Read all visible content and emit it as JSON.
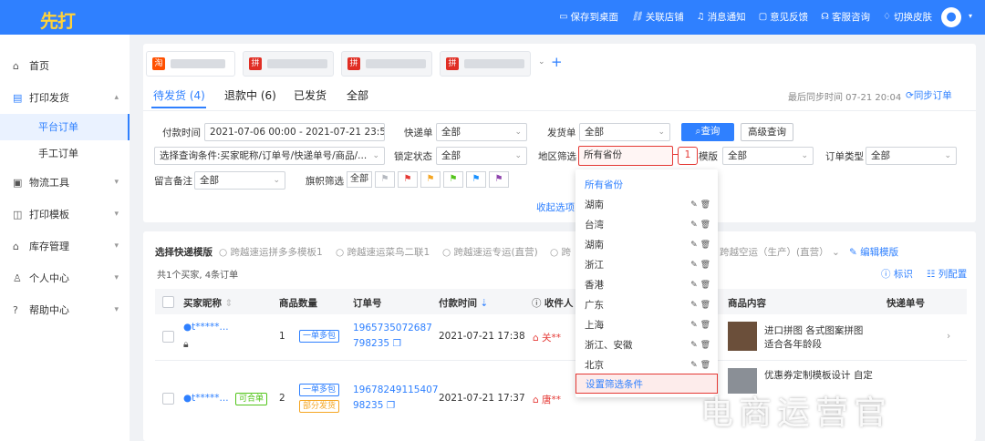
{
  "app": {
    "logo": "先打"
  },
  "topnav": [
    {
      "icon": "screen-icon",
      "label": "保存到桌面"
    },
    {
      "icon": "link-icon",
      "label": "关联店铺"
    },
    {
      "icon": "bell-icon",
      "label": "消息通知"
    },
    {
      "icon": "feedback-icon",
      "label": "意见反馈"
    },
    {
      "icon": "headset-icon",
      "label": "客服咨询"
    },
    {
      "icon": "shirt-icon",
      "label": "切换皮肤"
    }
  ],
  "sidebar": {
    "items": [
      {
        "icon": "home-icon",
        "label": "首页"
      },
      {
        "icon": "printer-icon",
        "label": "打印发货"
      },
      {
        "icon": "truck-icon",
        "label": "物流工具"
      },
      {
        "icon": "template-icon",
        "label": "打印模板"
      },
      {
        "icon": "store-icon",
        "label": "库存管理"
      },
      {
        "icon": "user-icon",
        "label": "个人中心"
      },
      {
        "icon": "help-icon",
        "label": "帮助中心"
      }
    ],
    "sub": [
      {
        "label": "平台订单"
      },
      {
        "label": "手工订单"
      }
    ]
  },
  "shops": [
    {
      "badge": "淘",
      "color": "#ff5000"
    },
    {
      "badge": "拼",
      "color": "#e02e24"
    },
    {
      "badge": "拼",
      "color": "#e02e24"
    },
    {
      "badge": "拼",
      "color": "#e02e24"
    }
  ],
  "tabs": [
    {
      "label": "待发货 (4)"
    },
    {
      "label": "退款中 (6)"
    },
    {
      "label": "已发货"
    },
    {
      "label": "全部"
    }
  ],
  "sync": {
    "text": "最后同步时间 07-21 20:04",
    "link": "同步订单"
  },
  "filters": {
    "pay_time_label": "付款时间",
    "pay_time_value": "2021-07-06 00:00 - 2021-07-21 23:59",
    "express_label": "快递单",
    "express_value": "全部",
    "ship_label": "发货单",
    "ship_value": "全部",
    "query_btn": "查询",
    "adv_btn": "高级查询",
    "cond_value": "选择查询条件:买家昵称/订单号/快递单号/商品/...",
    "lock_label": "锁定状态",
    "lock_value": "全部",
    "region_label": "地区筛选",
    "region_value": "所有省份",
    "template_label": "模版",
    "template_value": "全部",
    "order_type_label": "订单类型",
    "order_type_value": "全部",
    "remark_label": "留言备注",
    "remark_value": "全部",
    "flag_label": "旗帜筛选",
    "flag_all": "全部",
    "collapse": "收起选项",
    "callout": "1"
  },
  "flags": [
    "#b5b9c0",
    "#e53935",
    "#f5a623",
    "#52c41a",
    "#1890ff",
    "#8e44ad"
  ],
  "region_dropdown": {
    "header": "所有省份",
    "items": [
      "湖南",
      "台湾",
      "湖南",
      "浙江",
      "香港",
      "广东",
      "上海",
      "浙江、安徽",
      "北京"
    ],
    "footer": "设置筛选条件"
  },
  "express_select": {
    "label": "选择快递模版",
    "options": [
      "跨越速运拼多多模板1",
      "跨越速运菜鸟二联1",
      "跨越速运专运(直营)",
      "跨",
      "跨越空运（生产）(直营）"
    ],
    "edit": "编辑模版"
  },
  "summary": {
    "text": "共1个买家,   4条订单",
    "mark": "标识",
    "columns_cfg": "列配置"
  },
  "columns": [
    "买家昵称",
    "商品数量",
    "订单号",
    "付款时间",
    "收件人",
    "商品内容",
    "快递单号"
  ],
  "rows": [
    {
      "buyer": "t*****...",
      "qty": "1",
      "tags": [
        "一单多包"
      ],
      "order_a": "1965735072687",
      "order_b": "798235",
      "time": "2021-07-21 17:38",
      "recv": "关**",
      "product": "进口拼图 各式图案拼图 适合各年龄段"
    },
    {
      "buyer": "t*****...",
      "merge": "可合单",
      "qty": "2",
      "tags": [
        "一单多包",
        "部分发货"
      ],
      "order_a": "19678249115407",
      "order_b": "98235",
      "time": "2021-07-21 17:37",
      "recv": "唐**",
      "product": "优惠券定制模板设计 自定"
    }
  ],
  "watermark": "电商运营官"
}
